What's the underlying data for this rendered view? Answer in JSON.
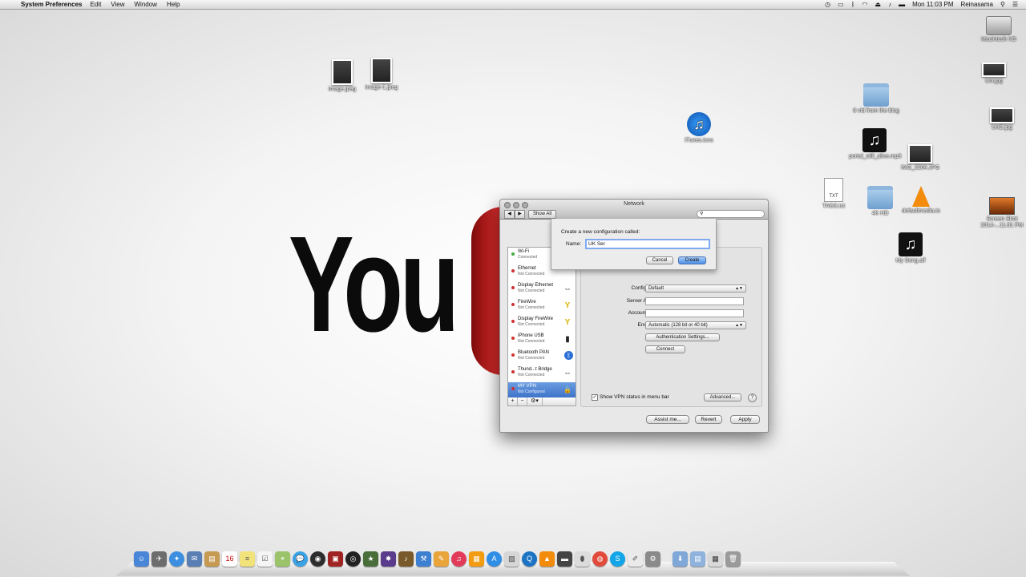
{
  "menubar": {
    "app_name": "System Preferences",
    "menus": [
      "Edit",
      "View",
      "Window",
      "Help"
    ],
    "clock": "Mon 11:03 PM",
    "user": "Reinasama"
  },
  "desktop": {
    "icons": [
      {
        "label": "Macintosh HD",
        "kind": "drive"
      },
      {
        "label": "image.jpeg",
        "kind": "photo"
      },
      {
        "label": "image-1.jpeg",
        "kind": "photo"
      },
      {
        "label": "iTunes.icns",
        "kind": "itunes"
      },
      {
        "label": "8 vid from the blog",
        "kind": "folder"
      },
      {
        "label": "portal_still_alive.mp3",
        "kind": "music"
      },
      {
        "label": "IMG_3164.JPG",
        "kind": "photo"
      },
      {
        "label": "TAGS.txt",
        "kind": "doc"
      },
      {
        "label": "4K HD",
        "kind": "folder"
      },
      {
        "label": "defaultmedia.ts",
        "kind": "vlc"
      },
      {
        "label": "My Song.aif",
        "kind": "music"
      },
      {
        "label": "Uni.jpg",
        "kind": "photo"
      },
      {
        "label": "Uni2.jpg",
        "kind": "photo"
      },
      {
        "label": "Screen Shot 2014-...11.01 PM",
        "kind": "screen"
      }
    ]
  },
  "background": {
    "logo_text": "You"
  },
  "window": {
    "title": "Network",
    "show_all": "Show All",
    "services": [
      {
        "name": "Wi-Fi",
        "status": "Connected",
        "dot": "#3fae3f",
        "icon": ""
      },
      {
        "name": "Ethernet",
        "status": "Not Connected",
        "dot": "#d03030",
        "icon": ""
      },
      {
        "name": "Display Ethernet",
        "status": "Not Connected",
        "dot": "#d03030",
        "icon": "⇔"
      },
      {
        "name": "FireWire",
        "status": "Not Connected",
        "dot": "#d03030",
        "icon": "Y"
      },
      {
        "name": "Display FireWire",
        "status": "Not Connected",
        "dot": "#d03030",
        "icon": "Y"
      },
      {
        "name": "iPhone USB",
        "status": "Not Connected",
        "dot": "#d03030",
        "icon": "▮"
      },
      {
        "name": "Bluetooth PAN",
        "status": "Not Connected",
        "dot": "#d03030",
        "icon": "ᛒ"
      },
      {
        "name": "Thund...t Bridge",
        "status": "Not Connected",
        "dot": "#d03030",
        "icon": "⇔"
      },
      {
        "name": "MY VPN",
        "status": "Not Configured",
        "dot": "#d03030",
        "icon": "🔒"
      }
    ],
    "list_controls": [
      "+",
      "−",
      "⚙▾"
    ],
    "fields": {
      "configuration_label": "Configuration:",
      "configuration_value": "Default",
      "server_label": "Server Address:",
      "account_label": "Account Name:",
      "encryption_label": "Encryption:",
      "encryption_value": "Automatic (128 bit or 40 bit)"
    },
    "auth_button": "Authentication Settings...",
    "connect_button": "Connect",
    "show_vpn_status": "Show VPN status in menu bar",
    "advanced_button": "Advanced...",
    "help": "?",
    "assist_button": "Assist me...",
    "revert_button": "Revert",
    "apply_button": "Apply"
  },
  "sheet": {
    "prompt": "Create a new configuration called:",
    "name_label": "Name:",
    "name_value": "UK Ser",
    "cancel": "Cancel",
    "create": "Create"
  },
  "accent_color": "#3a6fc7"
}
